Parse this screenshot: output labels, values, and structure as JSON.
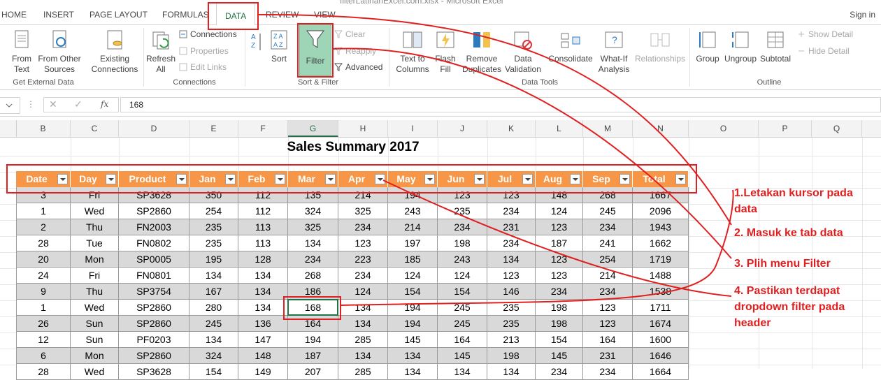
{
  "title_fragment": "filterLatihanExcel.com.xlsx - Microsoft Excel",
  "tabs": [
    {
      "label": "HOME"
    },
    {
      "label": "INSERT"
    },
    {
      "label": "PAGE LAYOUT"
    },
    {
      "label": "FORMULAS"
    },
    {
      "label": "DATA"
    },
    {
      "label": "REVIEW"
    },
    {
      "label": "VIEW"
    }
  ],
  "active_tab": "DATA",
  "signin": "Sign in",
  "ribbon": {
    "get_external": {
      "label": "Get External Data",
      "from_text": "From\nText",
      "from_other": "From Other\nSources",
      "existing": "Existing\nConnections"
    },
    "connections": {
      "label": "Connections",
      "refresh": "Refresh\nAll",
      "connections": "Connections",
      "properties": "Properties",
      "edit_links": "Edit Links"
    },
    "sort_filter": {
      "label": "Sort & Filter",
      "sort": "Sort",
      "filter": "Filter",
      "clear": "Clear",
      "reapply": "Reapply",
      "advanced": "Advanced"
    },
    "data_tools": {
      "label": "Data Tools",
      "text_to_columns": "Text to\nColumns",
      "flash_fill": "Flash\nFill",
      "remove_duplicates": "Remove\nDuplicates",
      "data_validation": "Data\nValidation",
      "consolidate": "Consolidate",
      "what_if": "What-If\nAnalysis",
      "relationships": "Relationships"
    },
    "outline": {
      "label": "Outline",
      "group": "Group",
      "ungroup": "Ungroup",
      "subtotal": "Subtotal",
      "show_detail": "Show Detail",
      "hide_detail": "Hide Detail"
    }
  },
  "formula_bar": {
    "fx": "fx",
    "value": "168"
  },
  "column_headers": [
    "B",
    "C",
    "D",
    "E",
    "F",
    "G",
    "H",
    "I",
    "J",
    "K",
    "L",
    "M",
    "N",
    "O",
    "P",
    "Q"
  ],
  "sheet": {
    "title": "Sales Summary 2017",
    "headers": [
      "Date",
      "Day",
      "Product",
      "Jan",
      "Feb",
      "Mar",
      "Apr",
      "May",
      "Jun",
      "Jul",
      "Aug",
      "Sep",
      "Total"
    ],
    "rows": [
      [
        "3",
        "Fri",
        "SP3628",
        "350",
        "112",
        "135",
        "214",
        "194",
        "123",
        "123",
        "148",
        "268",
        "1667"
      ],
      [
        "1",
        "Wed",
        "SP2860",
        "254",
        "112",
        "324",
        "325",
        "243",
        "235",
        "234",
        "124",
        "245",
        "2096"
      ],
      [
        "2",
        "Thu",
        "FN2003",
        "235",
        "113",
        "325",
        "234",
        "214",
        "234",
        "231",
        "123",
        "234",
        "1943"
      ],
      [
        "28",
        "Tue",
        "FN0802",
        "235",
        "113",
        "134",
        "123",
        "197",
        "198",
        "234",
        "187",
        "241",
        "1662"
      ],
      [
        "20",
        "Mon",
        "SP0005",
        "195",
        "128",
        "234",
        "223",
        "185",
        "243",
        "134",
        "123",
        "254",
        "1719"
      ],
      [
        "24",
        "Fri",
        "FN0801",
        "134",
        "134",
        "268",
        "234",
        "124",
        "124",
        "123",
        "123",
        "214",
        "1488"
      ],
      [
        "9",
        "Thu",
        "SP3754",
        "167",
        "134",
        "186",
        "124",
        "154",
        "154",
        "146",
        "234",
        "234",
        "1538"
      ],
      [
        "1",
        "Wed",
        "SP2860",
        "280",
        "134",
        "168",
        "134",
        "194",
        "245",
        "235",
        "198",
        "123",
        "1711"
      ],
      [
        "26",
        "Sun",
        "SP2860",
        "245",
        "136",
        "164",
        "134",
        "194",
        "245",
        "235",
        "198",
        "123",
        "1674"
      ],
      [
        "12",
        "Sun",
        "PF0203",
        "134",
        "147",
        "194",
        "285",
        "145",
        "164",
        "213",
        "154",
        "164",
        "1600"
      ],
      [
        "6",
        "Mon",
        "SP2860",
        "324",
        "148",
        "187",
        "134",
        "134",
        "145",
        "198",
        "145",
        "231",
        "1646"
      ],
      [
        "28",
        "Wed",
        "SP3628",
        "154",
        "149",
        "207",
        "285",
        "134",
        "134",
        "134",
        "234",
        "234",
        "1664"
      ]
    ]
  },
  "annotations": [
    "1.Letakan kursor pada data",
    "2. Masuk ke tab data",
    "3. Plih menu Filter",
    "4. Pastikan terdapat dropdown filter pada header"
  ],
  "colors": {
    "accent": "#217346",
    "header_fill": "#f79646",
    "band": "#d9d9d9",
    "annotation": "#e02020"
  }
}
